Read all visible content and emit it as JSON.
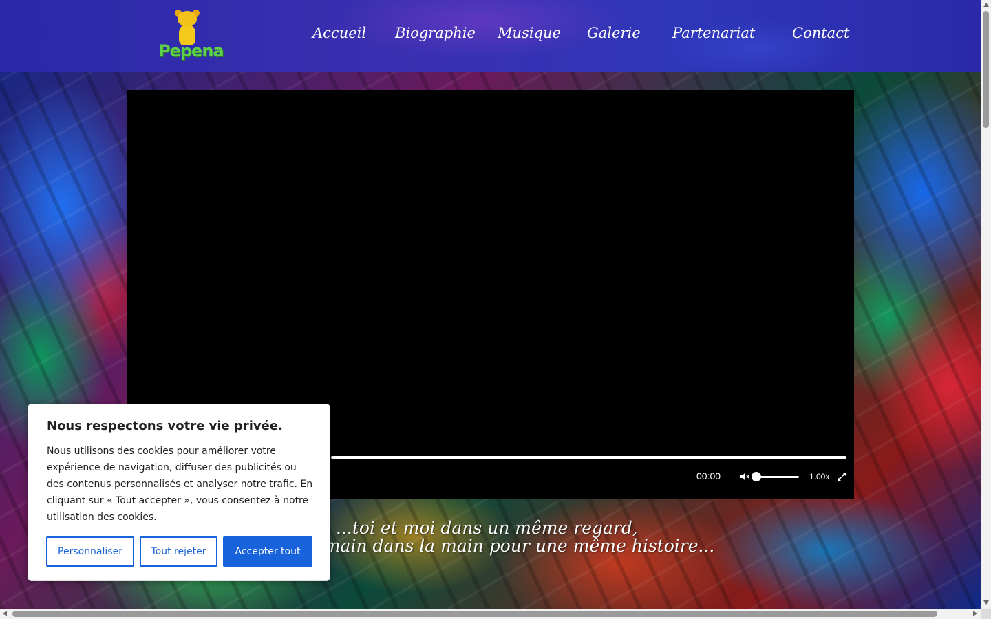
{
  "site": {
    "logo_text": "Pepena"
  },
  "nav": {
    "items": [
      {
        "label": "Accueil"
      },
      {
        "label": "Biographie"
      },
      {
        "label": "Musique"
      },
      {
        "label": "Galerie"
      },
      {
        "label": "Partenariat"
      },
      {
        "label": "Contact"
      }
    ]
  },
  "video": {
    "time": "00:00",
    "speed": "1.00x",
    "muted": true,
    "volume_fraction": 0,
    "progress_fraction": 0
  },
  "tagline": {
    "line1": "...toi et moi dans un même regard,",
    "line2": "la main dans la main pour une même histoire..."
  },
  "cookie": {
    "title": "Nous respectons votre vie privée.",
    "text": "Nous utilisons des cookies pour améliorer votre expérience de navigation, diffuser des publicités ou des contenus personnalisés et analyser notre trafic. En cliquant sur « Tout accepter », vous consentez à notre utilisation des cookies.",
    "customize_label": "Personnaliser",
    "reject_label": "Tout rejeter",
    "accept_label": "Accepter tout"
  },
  "colors": {
    "accent": "#1863dc",
    "logo_green": "#5ed14a",
    "logo_yellow": "#f2c21a",
    "header_blue": "#2e36b8"
  }
}
